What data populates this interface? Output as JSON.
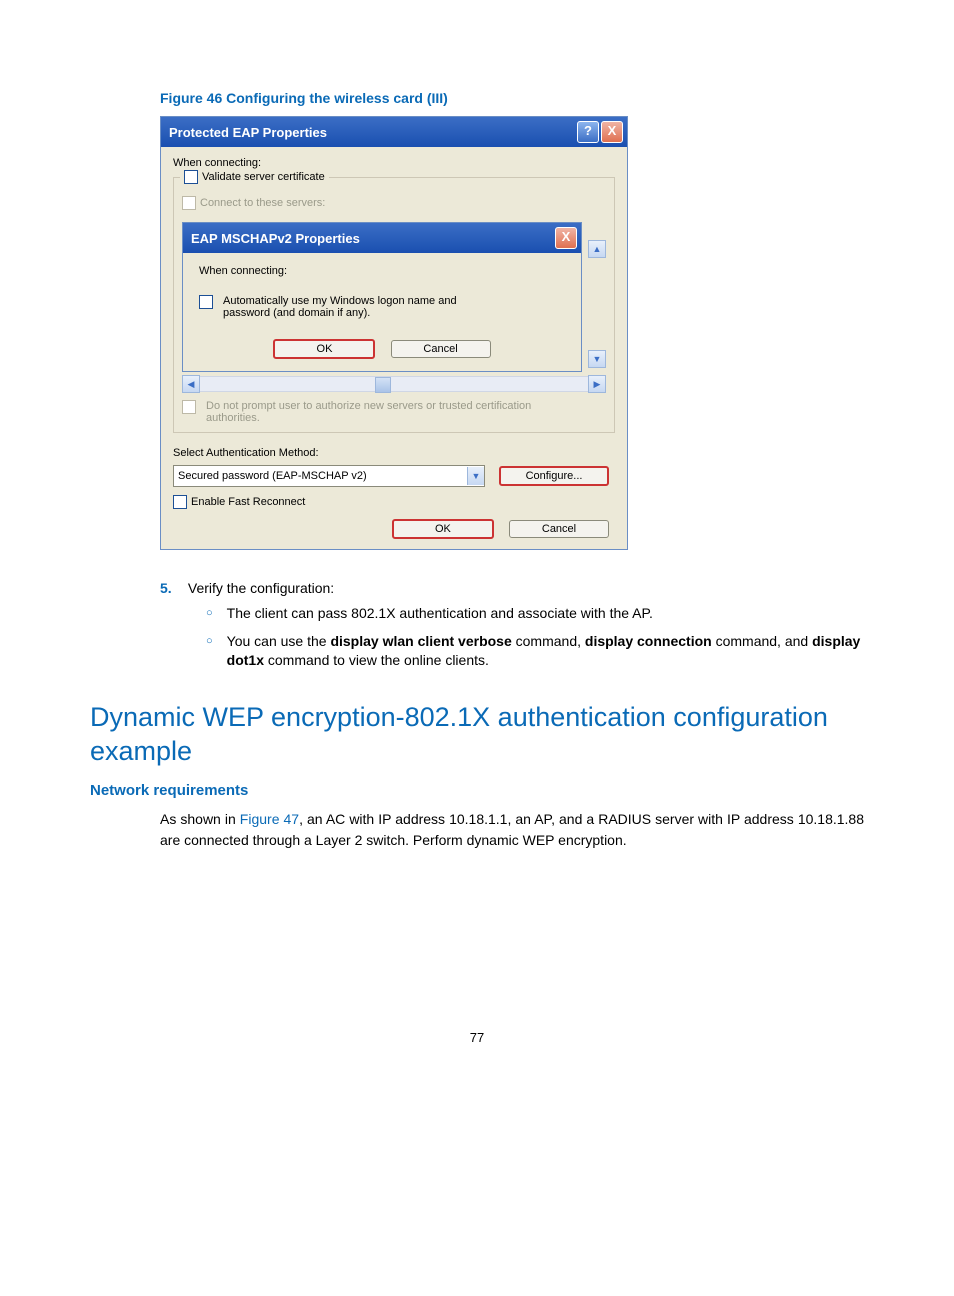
{
  "figure_caption": "Figure 46 Configuring the wireless card (III)",
  "outer_dialog": {
    "title": "Protected EAP Properties",
    "help_icon": "?",
    "close_icon": "X",
    "when_connecting": "When connecting:",
    "validate_cert": "Validate server certificate",
    "connect_servers": "Connect to these servers:",
    "do_not_prompt": "Do not prompt user to authorize new servers or trusted certification authorities.",
    "select_auth_label": "Select Authentication Method:",
    "auth_method_value": "Secured password (EAP-MSCHAP v2)",
    "configure_btn": "Configure...",
    "fast_reconnect": "Enable Fast Reconnect",
    "ok": "OK",
    "cancel": "Cancel"
  },
  "inner_dialog": {
    "title": "EAP MSCHAPv2 Properties",
    "close_icon": "X",
    "when_connecting": "When connecting:",
    "auto_logon": "Automatically use my Windows logon name and password (and domain if any).",
    "ok": "OK",
    "cancel": "Cancel"
  },
  "step": {
    "num": "5.",
    "text": "Verify the configuration:",
    "sub1": "The client can pass 802.1X authentication and associate with the AP.",
    "sub2_a": "You can use the ",
    "sub2_b": "display wlan client verbose",
    "sub2_c": " command, ",
    "sub2_d": "display connection",
    "sub2_e": " command, and ",
    "sub2_f": "display dot1x",
    "sub2_g": " command to view the online clients."
  },
  "h2": "Dynamic WEP encryption-802.1X authentication configuration example",
  "h3": "Network requirements",
  "para_a": "As shown in ",
  "para_link": "Figure 47",
  "para_b": ", an AC with IP address 10.18.1.1, an AP, and a RADIUS server with IP address 10.18.1.88 are connected through a Layer 2 switch. Perform dynamic WEP encryption.",
  "page_number": "77"
}
